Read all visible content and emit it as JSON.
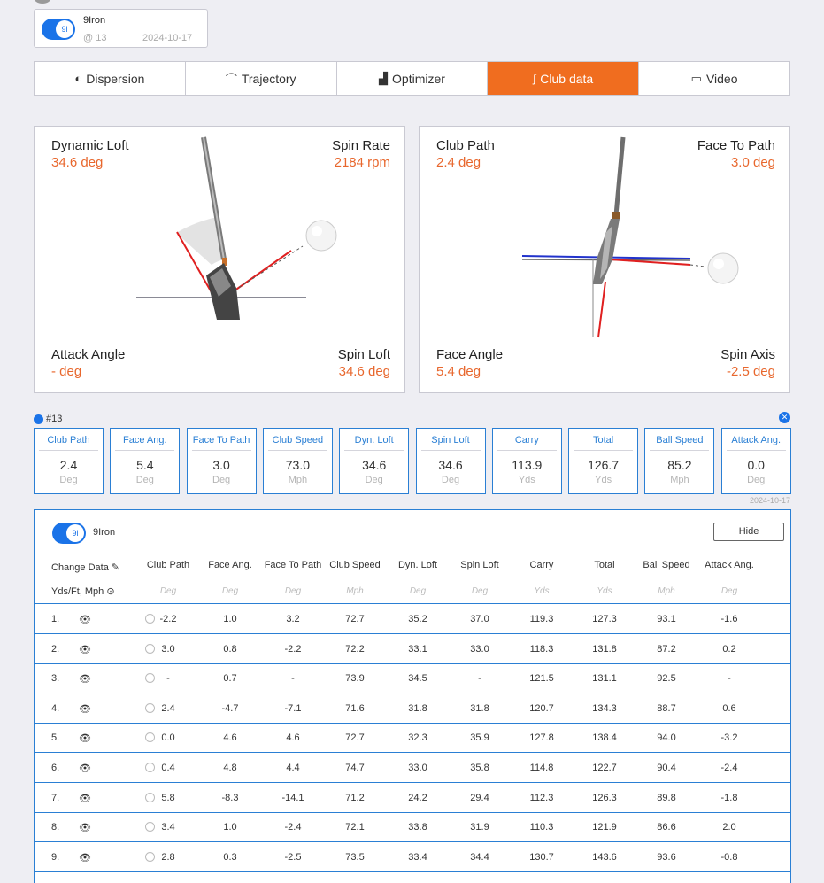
{
  "club_selector": {
    "name": "9Iron",
    "badge": "9i",
    "shot": "@ 13",
    "date": "2024-10-17"
  },
  "tabs": [
    {
      "label": "Dispersion",
      "icon": "dispersion-icon",
      "active": false
    },
    {
      "label": "Trajectory",
      "icon": "trajectory-icon",
      "active": false
    },
    {
      "label": "Optimizer",
      "icon": "optimizer-icon",
      "active": false
    },
    {
      "label": "Club data",
      "icon": "club-icon",
      "active": true
    },
    {
      "label": "Video",
      "icon": "video-icon",
      "active": false
    }
  ],
  "side_view": {
    "dynamic_loft": {
      "label": "Dynamic Loft",
      "value": "34.6 deg"
    },
    "spin_rate": {
      "label": "Spin Rate",
      "value": "2184 rpm"
    },
    "attack_angle": {
      "label": "Attack Angle",
      "value": "- deg"
    },
    "spin_loft": {
      "label": "Spin Loft",
      "value": "34.6 deg"
    }
  },
  "top_view": {
    "club_path": {
      "label": "Club Path",
      "value": "2.4 deg"
    },
    "face_to_path": {
      "label": "Face To Path",
      "value": "3.0 deg"
    },
    "face_angle": {
      "label": "Face Angle",
      "value": "5.4 deg"
    },
    "spin_axis": {
      "label": "Spin Axis",
      "value": "-2.5 deg"
    }
  },
  "summary": {
    "shot": "#13",
    "date": "2024-10-17",
    "cards": [
      {
        "label": "Club Path",
        "value": "2.4",
        "unit": "Deg"
      },
      {
        "label": "Face Ang.",
        "value": "5.4",
        "unit": "Deg"
      },
      {
        "label": "Face To Path",
        "value": "3.0",
        "unit": "Deg"
      },
      {
        "label": "Club Speed",
        "value": "73.0",
        "unit": "Mph"
      },
      {
        "label": "Dyn. Loft",
        "value": "34.6",
        "unit": "Deg"
      },
      {
        "label": "Spin Loft",
        "value": "34.6",
        "unit": "Deg"
      },
      {
        "label": "Carry",
        "value": "113.9",
        "unit": "Yds"
      },
      {
        "label": "Total",
        "value": "126.7",
        "unit": "Yds"
      },
      {
        "label": "Ball Speed",
        "value": "85.2",
        "unit": "Mph"
      },
      {
        "label": "Attack Ang.",
        "value": "0.0",
        "unit": "Deg"
      }
    ]
  },
  "table": {
    "club_name": "9Iron",
    "badge": "9i",
    "hide_label": "Hide",
    "change_data_label": "Change Data",
    "units_label": "Yds/Ft, Mph",
    "columns": [
      {
        "label": "Club Path",
        "unit": "Deg"
      },
      {
        "label": "Face Ang.",
        "unit": "Deg"
      },
      {
        "label": "Face To Path",
        "unit": "Deg"
      },
      {
        "label": "Club Speed",
        "unit": "Mph"
      },
      {
        "label": "Dyn. Loft",
        "unit": "Deg"
      },
      {
        "label": "Spin Loft",
        "unit": "Deg"
      },
      {
        "label": "Carry",
        "unit": "Yds"
      },
      {
        "label": "Total",
        "unit": "Yds"
      },
      {
        "label": "Ball Speed",
        "unit": "Mph"
      },
      {
        "label": "Attack Ang.",
        "unit": "Deg"
      }
    ],
    "rows": [
      {
        "n": "1.",
        "cells": [
          "-2.2",
          "1.0",
          "3.2",
          "72.7",
          "35.2",
          "37.0",
          "119.3",
          "127.3",
          "93.1",
          "-1.6"
        ]
      },
      {
        "n": "2.",
        "cells": [
          "3.0",
          "0.8",
          "-2.2",
          "72.2",
          "33.1",
          "33.0",
          "118.3",
          "131.8",
          "87.2",
          "0.2"
        ]
      },
      {
        "n": "3.",
        "cells": [
          "-",
          "0.7",
          "-",
          "73.9",
          "34.5",
          "-",
          "121.5",
          "131.1",
          "92.5",
          "-"
        ]
      },
      {
        "n": "4.",
        "cells": [
          "2.4",
          "-4.7",
          "-7.1",
          "71.6",
          "31.8",
          "31.8",
          "120.7",
          "134.3",
          "88.7",
          "0.6"
        ]
      },
      {
        "n": "5.",
        "cells": [
          "0.0",
          "4.6",
          "4.6",
          "72.7",
          "32.3",
          "35.9",
          "127.8",
          "138.4",
          "94.0",
          "-3.2"
        ]
      },
      {
        "n": "6.",
        "cells": [
          "0.4",
          "4.8",
          "4.4",
          "74.7",
          "33.0",
          "35.8",
          "114.8",
          "122.7",
          "90.4",
          "-2.4"
        ]
      },
      {
        "n": "7.",
        "cells": [
          "5.8",
          "-8.3",
          "-14.1",
          "71.2",
          "24.2",
          "29.4",
          "112.3",
          "126.3",
          "89.8",
          "-1.8"
        ]
      },
      {
        "n": "8.",
        "cells": [
          "3.4",
          "1.0",
          "-2.4",
          "72.1",
          "33.8",
          "31.9",
          "110.3",
          "121.9",
          "86.6",
          "2.0"
        ]
      },
      {
        "n": "9.",
        "cells": [
          "2.8",
          "0.3",
          "-2.5",
          "73.5",
          "33.4",
          "34.4",
          "130.7",
          "143.6",
          "93.6",
          "-0.8"
        ]
      }
    ]
  }
}
